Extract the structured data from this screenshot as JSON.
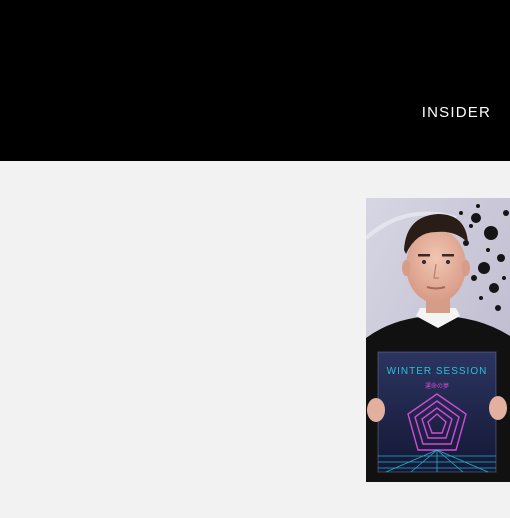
{
  "header": {
    "brand_label": "INSIDER"
  },
  "photo": {
    "alt": "Person holding vinyl record",
    "album_title": "WINTER SESSION",
    "album_subtitle": "運命の夢"
  },
  "colors": {
    "header_bg": "#000000",
    "page_bg": "#f2f2f2",
    "brand_text": "#ffffff",
    "album_accent_pink": "#d24ad8",
    "album_accent_cyan": "#27c1d8"
  }
}
